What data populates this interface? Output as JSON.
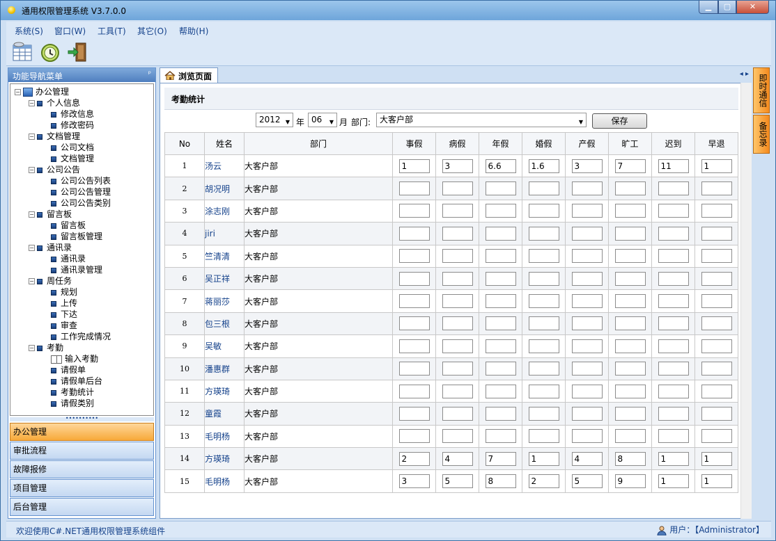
{
  "window": {
    "title": "通用权限管理系统 V3.7.0.0"
  },
  "menu": [
    "系统(S)",
    "窗口(W)",
    "工具(T)",
    "其它(O)",
    "帮助(H)"
  ],
  "toolbar": [
    {
      "icon": "table-icon"
    },
    {
      "icon": "clock-history-icon"
    },
    {
      "icon": "exit-door-icon"
    }
  ],
  "nav": {
    "title": "功能导航菜单",
    "pin": "ᵖ",
    "tree": [
      {
        "label": "办公管理",
        "level": 0,
        "type": "root"
      },
      {
        "label": "个人信息",
        "level": 1,
        "type": "folder"
      },
      {
        "label": "修改信息",
        "level": 2,
        "type": "leaf"
      },
      {
        "label": "修改密码",
        "level": 2,
        "type": "leaf"
      },
      {
        "label": "文档管理",
        "level": 1,
        "type": "folder"
      },
      {
        "label": "公司文档",
        "level": 2,
        "type": "leaf"
      },
      {
        "label": "文档管理",
        "level": 2,
        "type": "leaf"
      },
      {
        "label": "公司公告",
        "level": 1,
        "type": "folder"
      },
      {
        "label": "公司公告列表",
        "level": 2,
        "type": "leaf"
      },
      {
        "label": "公司公告管理",
        "level": 2,
        "type": "leaf"
      },
      {
        "label": "公司公告类别",
        "level": 2,
        "type": "leaf"
      },
      {
        "label": "留言板",
        "level": 1,
        "type": "folder"
      },
      {
        "label": "留言板",
        "level": 2,
        "type": "leaf"
      },
      {
        "label": "留言板管理",
        "level": 2,
        "type": "leaf"
      },
      {
        "label": "通讯录",
        "level": 1,
        "type": "folder"
      },
      {
        "label": "通讯录",
        "level": 2,
        "type": "leaf"
      },
      {
        "label": "通讯录管理",
        "level": 2,
        "type": "leaf"
      },
      {
        "label": "周任务",
        "level": 1,
        "type": "folder"
      },
      {
        "label": "规划",
        "level": 2,
        "type": "leaf"
      },
      {
        "label": "上传",
        "level": 2,
        "type": "leaf"
      },
      {
        "label": "下达",
        "level": 2,
        "type": "leaf"
      },
      {
        "label": "审查",
        "level": 2,
        "type": "leaf"
      },
      {
        "label": "工作完成情况",
        "level": 2,
        "type": "leaf"
      },
      {
        "label": "考勤",
        "level": 1,
        "type": "folder"
      },
      {
        "label": "输入考勤",
        "level": 2,
        "type": "book"
      },
      {
        "label": "请假单",
        "level": 2,
        "type": "leaf"
      },
      {
        "label": "请假单后台",
        "level": 2,
        "type": "leaf"
      },
      {
        "label": "考勤统计",
        "level": 2,
        "type": "leaf"
      },
      {
        "label": "请假类别",
        "level": 2,
        "type": "leaf"
      }
    ],
    "splitter": "••••••••••",
    "buttons": [
      {
        "label": "办公管理",
        "active": true
      },
      {
        "label": "审批流程",
        "active": false
      },
      {
        "label": "故障报修",
        "active": false
      },
      {
        "label": "项目管理",
        "active": false
      },
      {
        "label": "后台管理",
        "active": false
      }
    ]
  },
  "tab": {
    "label": "浏览页面",
    "arrows": "◂ ▸"
  },
  "page": {
    "title": "考勤统计",
    "year": "2012",
    "year_suffix": "年",
    "month": "06",
    "month_suffix": "月",
    "dept_label": "部门:",
    "dept": "大客户部",
    "save": "保存"
  },
  "table": {
    "headers": [
      "No",
      "姓名",
      "部门",
      "事假",
      "病假",
      "年假",
      "婚假",
      "产假",
      "旷工",
      "迟到",
      "早退"
    ],
    "rows": [
      {
        "no": "1",
        "name": "汤云",
        "dept": "大客户部",
        "v": [
          "1",
          "3",
          "6.6",
          "1.6",
          "3",
          "7",
          "11",
          "1"
        ]
      },
      {
        "no": "2",
        "name": "胡况明",
        "dept": "大客户部",
        "v": [
          "",
          "",
          "",
          "",
          "",
          "",
          "",
          ""
        ]
      },
      {
        "no": "3",
        "name": "涂志刚",
        "dept": "大客户部",
        "v": [
          "",
          "",
          "",
          "",
          "",
          "",
          "",
          ""
        ]
      },
      {
        "no": "4",
        "name": "jiri",
        "dept": "大客户部",
        "v": [
          "",
          "",
          "",
          "",
          "",
          "",
          "",
          ""
        ]
      },
      {
        "no": "5",
        "name": "竺清清",
        "dept": "大客户部",
        "v": [
          "",
          "",
          "",
          "",
          "",
          "",
          "",
          ""
        ]
      },
      {
        "no": "6",
        "name": "吴正祥",
        "dept": "大客户部",
        "v": [
          "",
          "",
          "",
          "",
          "",
          "",
          "",
          ""
        ]
      },
      {
        "no": "7",
        "name": "蒋丽莎",
        "dept": "大客户部",
        "v": [
          "",
          "",
          "",
          "",
          "",
          "",
          "",
          ""
        ]
      },
      {
        "no": "8",
        "name": "包三根",
        "dept": "大客户部",
        "v": [
          "",
          "",
          "",
          "",
          "",
          "",
          "",
          ""
        ]
      },
      {
        "no": "9",
        "name": "吴敏",
        "dept": "大客户部",
        "v": [
          "",
          "",
          "",
          "",
          "",
          "",
          "",
          ""
        ]
      },
      {
        "no": "10",
        "name": "潘惠群",
        "dept": "大客户部",
        "v": [
          "",
          "",
          "",
          "",
          "",
          "",
          "",
          ""
        ]
      },
      {
        "no": "11",
        "name": "方瑛琦",
        "dept": "大客户部",
        "v": [
          "",
          "",
          "",
          "",
          "",
          "",
          "",
          ""
        ]
      },
      {
        "no": "12",
        "name": "童霞",
        "dept": "大客户部",
        "v": [
          "",
          "",
          "",
          "",
          "",
          "",
          "",
          ""
        ]
      },
      {
        "no": "13",
        "name": "毛明杨",
        "dept": "大客户部",
        "v": [
          "",
          "",
          "",
          "",
          "",
          "",
          "",
          ""
        ]
      },
      {
        "no": "14",
        "name": "方瑛琦",
        "dept": "大客户部",
        "v": [
          "2",
          "4",
          "7",
          "1",
          "4",
          "8",
          "1",
          "1"
        ]
      },
      {
        "no": "15",
        "name": "毛明杨",
        "dept": "大客户部",
        "v": [
          "3",
          "5",
          "8",
          "2",
          "5",
          "9",
          "1",
          "1"
        ]
      }
    ]
  },
  "right_tabs": [
    "即时通信",
    "备忘录"
  ],
  "status": {
    "left": "欢迎使用C#.NET通用权限管理系统组件",
    "right": "用户：【Administrator】"
  }
}
